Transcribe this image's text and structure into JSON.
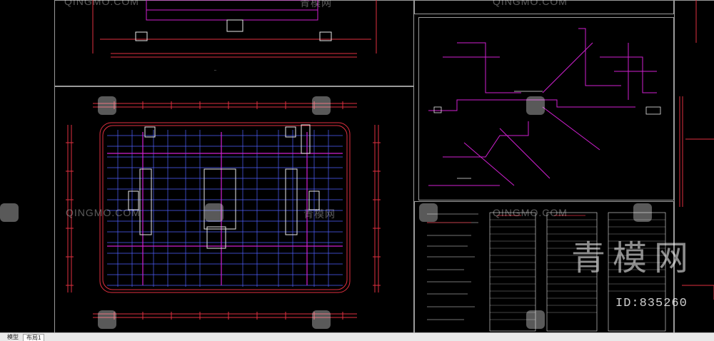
{
  "layout_tabs": {
    "model_label": "模型",
    "layout1_label": "布局1"
  },
  "watermark": {
    "text": "QINGMO.COM",
    "brand_cn": "青模网",
    "id_text": "ID:835260"
  },
  "colors": {
    "background": "#000000",
    "frame": "#9a9a9a",
    "drawing_red": "#e03040",
    "drawing_magenta": "#d020d0",
    "drawing_blue": "#5060ff",
    "drawing_white": "#e8e8e8"
  }
}
